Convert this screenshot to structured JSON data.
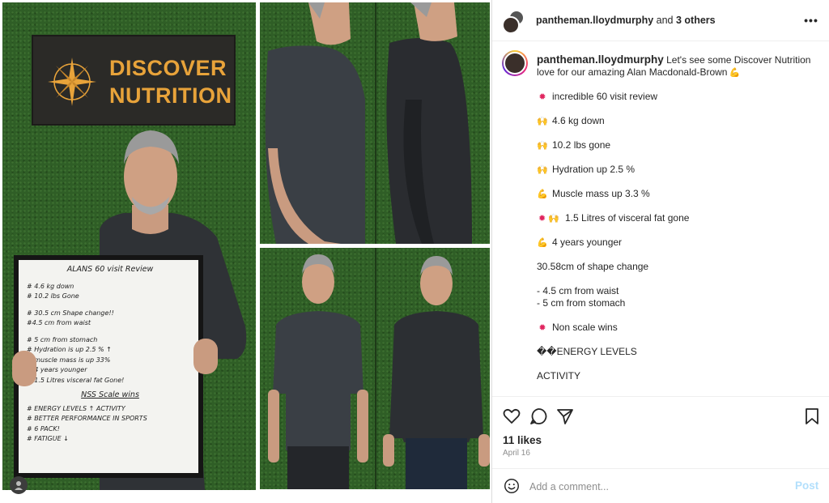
{
  "photo": {
    "sign": {
      "line1": "DISCOVER",
      "line2": "NUTRITION"
    },
    "board": {
      "title": "ALANS 60 visit Review",
      "lines": [
        "# 4.6 kg down",
        "# 10.2 lbs Gone",
        "",
        "# 30.5 cm Shape change!!",
        "#4.5 cm from waist",
        "",
        "# 5 cm from stomach",
        "# Hydration is up 2.5 % ↑",
        "# muscle mass is up 33%",
        "# 4 years younger",
        "# 1.5 Litres visceral fat Gone!"
      ],
      "subtitle": "NSS Scale wins",
      "lines2": [
        "# ENERGY LEVELS ↑ ACTIVITY",
        "# BETTER PERFORMANCE IN SPORTS",
        "# 6 PACK!",
        "# FATIGUE ↓"
      ]
    }
  },
  "header": {
    "username": "pantheman.lloydmurphy",
    "and": " and ",
    "others": "3 others",
    "more_icon": "•••"
  },
  "caption": {
    "username": "pantheman.lloydmurphy",
    "intro": " Let's see some Discover Nutrition love for our amazing Alan Macdonald-Brown",
    "intro_emoji": "💪",
    "lines": [
      {
        "emoji": "✹",
        "emoji_class": "e-burst",
        "text": "incredible 60 visit review"
      },
      {
        "emoji": "🙌",
        "emoji_class": "e-hands",
        "text": "4.6 kg down"
      },
      {
        "emoji": "🙌",
        "emoji_class": "e-hands",
        "text": "10.2 lbs gone"
      },
      {
        "emoji": "🙌",
        "emoji_class": "e-hands",
        "text": "Hydration up 2.5 %"
      },
      {
        "emoji": "💪",
        "emoji_class": "e-muscle",
        "text": "Muscle mass up 3.3 %"
      },
      {
        "emoji": "✹ 🙌",
        "emoji_class": "e-burst",
        "text": "1.5 Litres of visceral fat gone"
      },
      {
        "emoji": "💪",
        "emoji_class": "e-muscle",
        "text": "4 years younger"
      },
      {
        "emoji": "",
        "emoji_class": "",
        "text": "30.58cm of shape change"
      },
      {
        "emoji": "",
        "emoji_class": "",
        "text": "- 4.5 cm from waist"
      },
      {
        "emoji": "",
        "emoji_class": "",
        "text": "- 5 cm from stomach"
      },
      {
        "emoji": "✹",
        "emoji_class": "e-burst",
        "text": "Non scale wins"
      },
      {
        "emoji": "",
        "emoji_class": "",
        "text": "��ENERGY LEVELS"
      },
      {
        "emoji": "",
        "emoji_class": "",
        "text": "ACTIVITY"
      }
    ]
  },
  "actions": {
    "likes": "11 likes",
    "date": "April 16",
    "comment_placeholder": "Add a comment...",
    "post_label": "Post",
    "post_color": "#b2dffc"
  },
  "icons": [
    "heart-icon",
    "comment-icon",
    "share-icon",
    "bookmark-icon",
    "emoji-icon",
    "more-icon",
    "compass-icon",
    "sensitive-content-icon"
  ]
}
